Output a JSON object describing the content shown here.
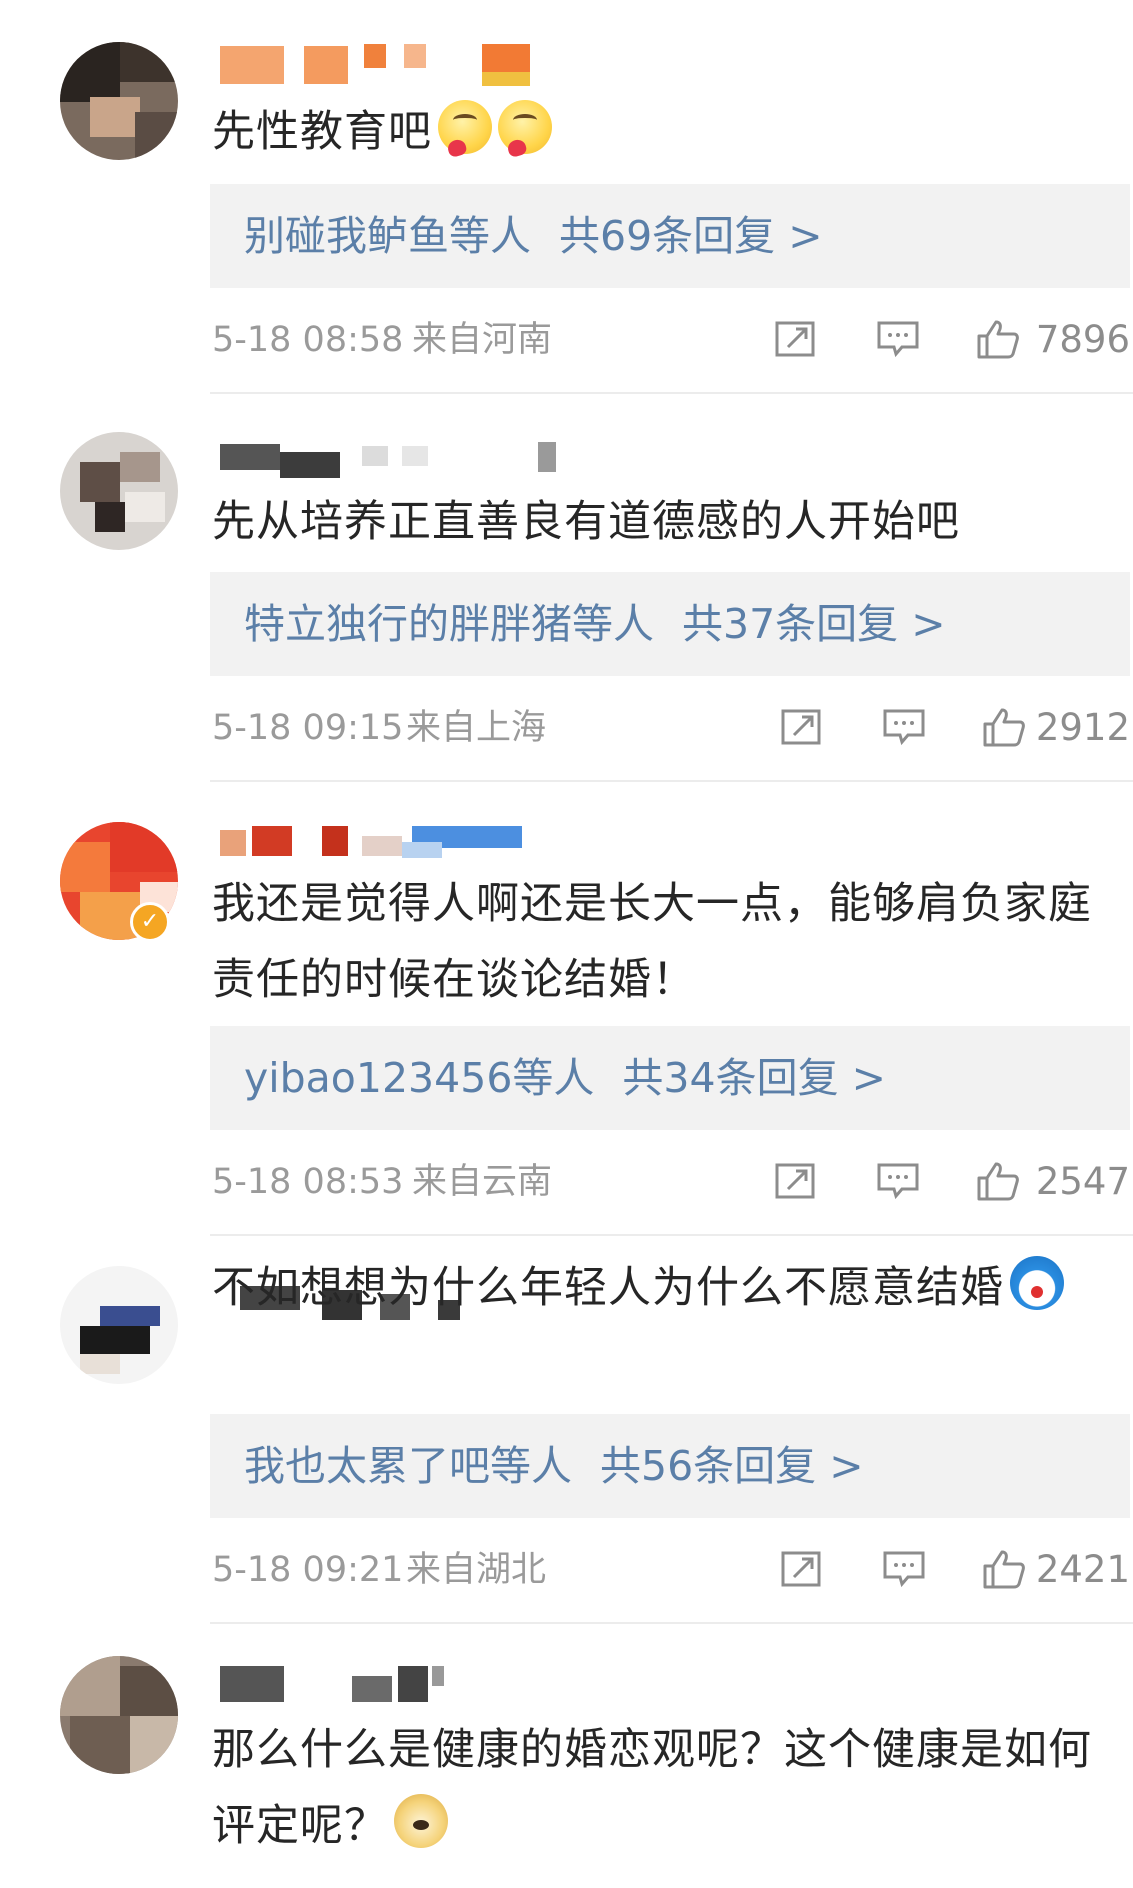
{
  "comments": [
    {
      "text": "先性教育吧",
      "emojis": [
        "blush-emoji",
        "blush-emoji"
      ],
      "replies": {
        "name": "别碰我鲈鱼",
        "suffix": "等人",
        "count_text": "共69条回复 >"
      },
      "time": "5-18 08:58",
      "location": "来自河南",
      "likes": "7896"
    },
    {
      "text": "先从培养正直善良有道德感的人开始吧",
      "emojis": [],
      "replies": {
        "name": "特立独行的胖胖猪",
        "suffix": "等人",
        "count_text": "共37条回复 >"
      },
      "time": "5-18 09:15",
      "location": "来自上海",
      "likes": "2912"
    },
    {
      "text": "我还是觉得人啊还是长大一点，能够肩负家庭责任的时候在谈论结婚！",
      "emojis": [],
      "replies": {
        "name": "yibao123456",
        "suffix": "等人",
        "count_text": "共34条回复 >"
      },
      "time": "5-18 08:53",
      "location": "来自云南",
      "likes": "2547"
    },
    {
      "text": "不如想想为什么年轻人为什么不愿意结婚",
      "emojis": [
        "doraemon-emoji"
      ],
      "replies": {
        "name": "我也太累了吧",
        "suffix": "等人",
        "count_text": "共56条回复 >"
      },
      "time": "5-18 09:21",
      "location": "来自湖北",
      "likes": "2421"
    },
    {
      "text": "那么什么是健康的婚恋观呢？这个健康是如何评定呢？",
      "emojis": [
        "doge-emoji"
      ]
    }
  ],
  "icons": {
    "share": "share-icon",
    "comment": "comment-icon",
    "like": "thumbs-up-icon"
  },
  "colors": {
    "reply_link": "#5b7fa8",
    "reply_bg": "#f2f2f2",
    "meta": "#9a9a9a",
    "verified": "#f5a623"
  }
}
